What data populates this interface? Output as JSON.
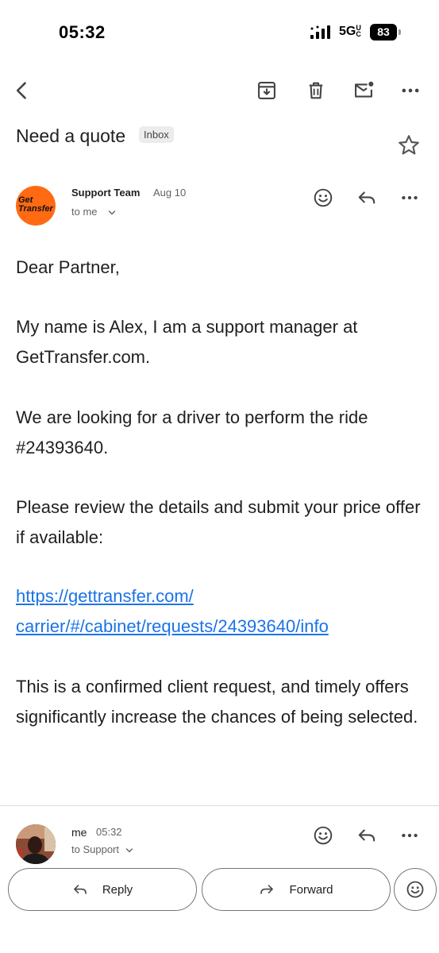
{
  "status_bar": {
    "time": "05:32",
    "network": "5G",
    "network_suffix": "UC",
    "battery": "83"
  },
  "toolbar": {
    "icons": [
      "back-arrow-icon",
      "archive-icon",
      "delete-icon",
      "mark-unread-icon",
      "more-vert-icon"
    ]
  },
  "email": {
    "subject": "Need a quote",
    "label": "Inbox",
    "sender": {
      "logo_line1": "Get",
      "logo_line2": "Transfer",
      "name": "Support Team",
      "date": "Aug 10",
      "recipient": "to me"
    },
    "body": {
      "greeting": "Dear Partner,",
      "p1": "My name is Alex, I am a support manager at GetTransfer.com.",
      "p2": "We are looking for a driver to perform the ride #24393640.",
      "p3": "Please review the details and submit your price offer if available:",
      "link_line1": "https://gettransfer.com/",
      "link_line2": "carrier/#/cabinet/requests/24393640/info",
      "p4": "This is a confirmed client request, and timely offers significantly increase the chances of being selected."
    }
  },
  "reply_thread": {
    "sender": "me",
    "time": "05:32",
    "recipient": "to Support"
  },
  "actions": {
    "reply_label": "Reply",
    "forward_label": "Forward"
  },
  "colors": {
    "link": "#1a73e8",
    "logo_bg": "#ff6a13",
    "text": "#1f1f1f",
    "muted": "#5f6368"
  }
}
